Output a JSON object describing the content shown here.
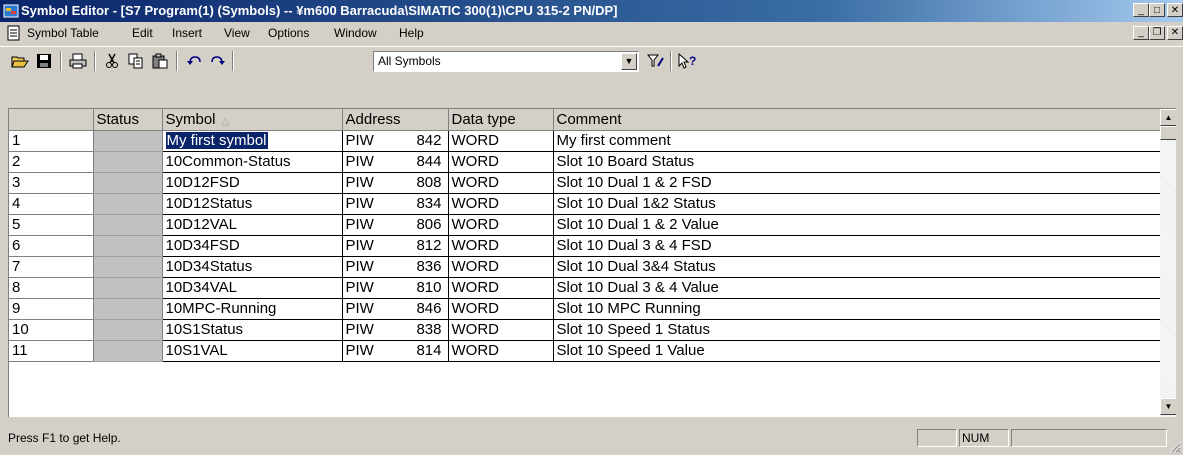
{
  "window": {
    "title": "Symbol Editor - [S7 Program(1) (Symbols) -- ¥m600 Barracuda\\SIMATIC 300(1)\\CPU 315-2 PN/DP]",
    "minimize_label": "_",
    "maximize_label": "□",
    "close_label": "✕"
  },
  "menubar": {
    "items": [
      "Symbol Table",
      "Edit",
      "Insert",
      "View",
      "Options",
      "Window",
      "Help"
    ],
    "mdi_min": "_",
    "mdi_restore": "❐",
    "mdi_close": "✕"
  },
  "toolbar": {
    "filter_value": "All Symbols",
    "buttons": [
      "open-icon",
      "save-icon",
      "print-icon",
      "cut-icon",
      "copy-icon",
      "paste-icon",
      "undo-icon",
      "redo-icon",
      "filter-icon",
      "help-pointer-icon"
    ]
  },
  "table": {
    "headers": {
      "status": "Status",
      "symbol": "Symbol",
      "address": "Address",
      "datatype": "Data type",
      "comment": "Comment"
    },
    "sort_indicator": "△",
    "rows": [
      {
        "num": "1",
        "symbol": "My first symbol",
        "area": "PIW",
        "offset": "842",
        "type": "WORD",
        "comment": "My first comment"
      },
      {
        "num": "2",
        "symbol": "10Common-Status",
        "area": "PIW",
        "offset": "844",
        "type": "WORD",
        "comment": "Slot 10 Board Status"
      },
      {
        "num": "3",
        "symbol": "10D12FSD",
        "area": "PIW",
        "offset": "808",
        "type": "WORD",
        "comment": "Slot 10 Dual 1 & 2 FSD"
      },
      {
        "num": "4",
        "symbol": "10D12Status",
        "area": "PIW",
        "offset": "834",
        "type": "WORD",
        "comment": "Slot 10 Dual 1&2 Status"
      },
      {
        "num": "5",
        "symbol": "10D12VAL",
        "area": "PIW",
        "offset": "806",
        "type": "WORD",
        "comment": "Slot 10 Dual 1 & 2 Value"
      },
      {
        "num": "6",
        "symbol": "10D34FSD",
        "area": "PIW",
        "offset": "812",
        "type": "WORD",
        "comment": "Slot 10 Dual 3 & 4 FSD"
      },
      {
        "num": "7",
        "symbol": "10D34Status",
        "area": "PIW",
        "offset": "836",
        "type": "WORD",
        "comment": "Slot 10 Dual 3&4 Status"
      },
      {
        "num": "8",
        "symbol": "10D34VAL",
        "area": "PIW",
        "offset": "810",
        "type": "WORD",
        "comment": "Slot 10 Dual 3 & 4 Value"
      },
      {
        "num": "9",
        "symbol": "10MPC-Running",
        "area": "PIW",
        "offset": "846",
        "type": "WORD",
        "comment": "Slot 10 MPC Running"
      },
      {
        "num": "10",
        "symbol": "10S1Status",
        "area": "PIW",
        "offset": "838",
        "type": "WORD",
        "comment": "Slot 10 Speed 1 Status"
      },
      {
        "num": "11",
        "symbol": "10S1VAL",
        "area": "PIW",
        "offset": "814",
        "type": "WORD",
        "comment": "Slot 10 Speed 1 Value"
      }
    ]
  },
  "statusbar": {
    "help_text": "Press F1 to get Help.",
    "num_indicator": "NUM"
  },
  "colors": {
    "titlebar_start": "#0a246a",
    "selection": "#0a246a",
    "chrome": "#d4d0c8",
    "status_cell": "#c0c0c0"
  }
}
